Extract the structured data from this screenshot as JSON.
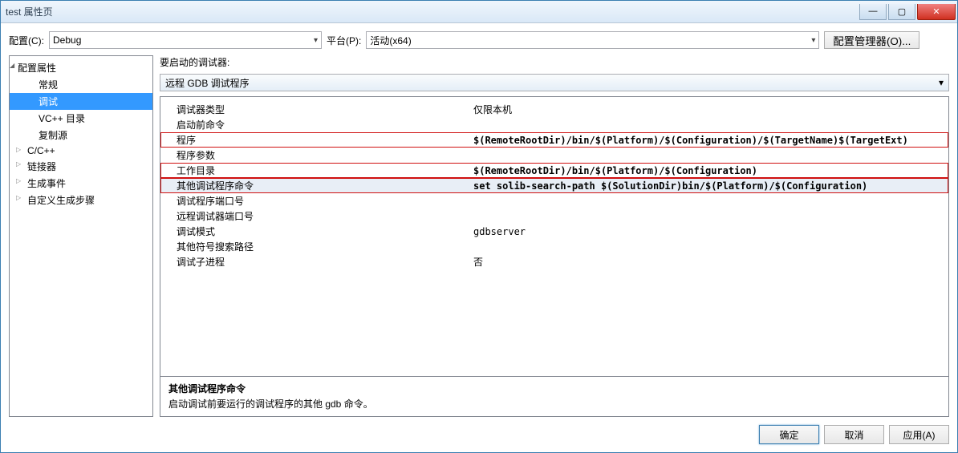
{
  "window": {
    "title": "test 属性页"
  },
  "toprow": {
    "config_label": "配置(C):",
    "config_value": "Debug",
    "platform_label": "平台(P):",
    "platform_value": "活动(x64)",
    "cfg_mgr": "配置管理器(O)..."
  },
  "tree": {
    "root": "配置属性",
    "items": [
      {
        "label": "常规",
        "collapsed": false
      },
      {
        "label": "调试",
        "selected": true
      },
      {
        "label": "VC++ 目录"
      },
      {
        "label": "复制源"
      },
      {
        "label": "C/C++",
        "collapsed": true
      },
      {
        "label": "链接器",
        "collapsed": true
      },
      {
        "label": "生成事件",
        "collapsed": true
      },
      {
        "label": "自定义生成步骤",
        "collapsed": true
      }
    ]
  },
  "right": {
    "launch_label": "要启动的调试器:",
    "debugger": "远程 GDB 调试程序",
    "rows": [
      {
        "k": "调试器类型",
        "v": "仅限本机"
      },
      {
        "k": "启动前命令",
        "v": ""
      },
      {
        "k": "程序",
        "v": "$(RemoteRootDir)/bin/$(Platform)/$(Configuration)/$(TargetName)$(TargetExt)",
        "hl": true
      },
      {
        "k": "程序参数",
        "v": ""
      },
      {
        "k": "工作目录",
        "v": "$(RemoteRootDir)/bin/$(Platform)/$(Configuration)",
        "hl": true
      },
      {
        "k": "其他调试程序命令",
        "v": "set solib-search-path $(SolutionDir)bin/$(Platform)/$(Configuration)",
        "hl": true,
        "sel": true
      },
      {
        "k": "调试程序端口号",
        "v": ""
      },
      {
        "k": "远程调试器端口号",
        "v": ""
      },
      {
        "k": "调试模式",
        "v": "gdbserver"
      },
      {
        "k": "其他符号搜索路径",
        "v": ""
      },
      {
        "k": "调试子进程",
        "v": "否"
      }
    ],
    "desc_title": "其他调试程序命令",
    "desc_body": "启动调试前要运行的调试程序的其他 gdb 命令。"
  },
  "footer": {
    "ok": "确定",
    "cancel": "取消",
    "apply": "应用(A)"
  }
}
